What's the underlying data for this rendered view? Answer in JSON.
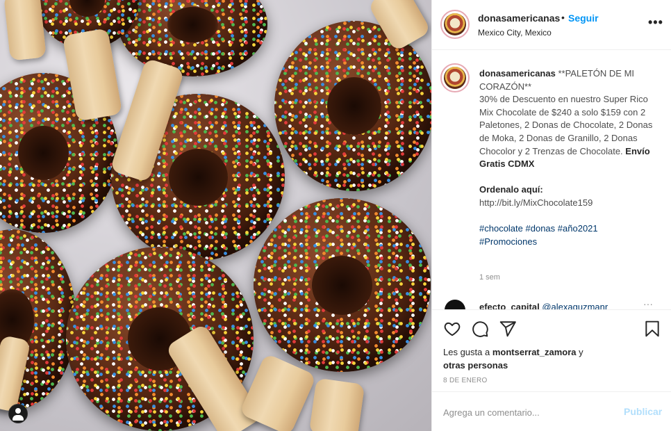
{
  "header": {
    "username": "donasamericanas",
    "separator": "•",
    "follow_label": "Seguir",
    "location": "Mexico City, Mexico",
    "more_icon": "more-horizontal-icon"
  },
  "caption": {
    "username": "donasamericanas",
    "title": "**PALETÓN DE MI CORAZÓN**",
    "body": "30% de Descuento en nuestro Super Rico Mix Chocolate de $240 a solo $159 con 2 Paletones, 2 Donas de Chocolate, 2 Donas de Moka, 2 Donas de Granillo, 2 Donas Chocolor y 2 Trenzas de Chocolate.",
    "body_bold": "Envío Gratis CDMX",
    "order_heading": "Ordenalo aquí:",
    "link": "http://bit.ly/MixChocolate159",
    "hashtags": [
      "#chocolate",
      "#donas",
      "#año2021",
      "#Promociones"
    ],
    "time": "1 sem"
  },
  "next_comment": {
    "username": "efecto_capital",
    "mention": "@alexaguzmanr",
    "more": "···"
  },
  "actions": {
    "like_icon": "heart-icon",
    "comment_icon": "comment-icon",
    "share_icon": "share-icon",
    "save_icon": "bookmark-icon"
  },
  "likes": {
    "prefix": "Les gusta a",
    "user": "montserrat_zamora",
    "and": "y",
    "others": "otras personas"
  },
  "date": "8 DE ENERO",
  "comment_box": {
    "placeholder": "Agrega un comentario...",
    "publish_label": "Publicar"
  },
  "colors": {
    "accent": "#0095f6",
    "publish_disabled": "#b2dffc",
    "hashtag": "#00376b",
    "muted": "#8e8e8e",
    "border": "#efefef"
  }
}
